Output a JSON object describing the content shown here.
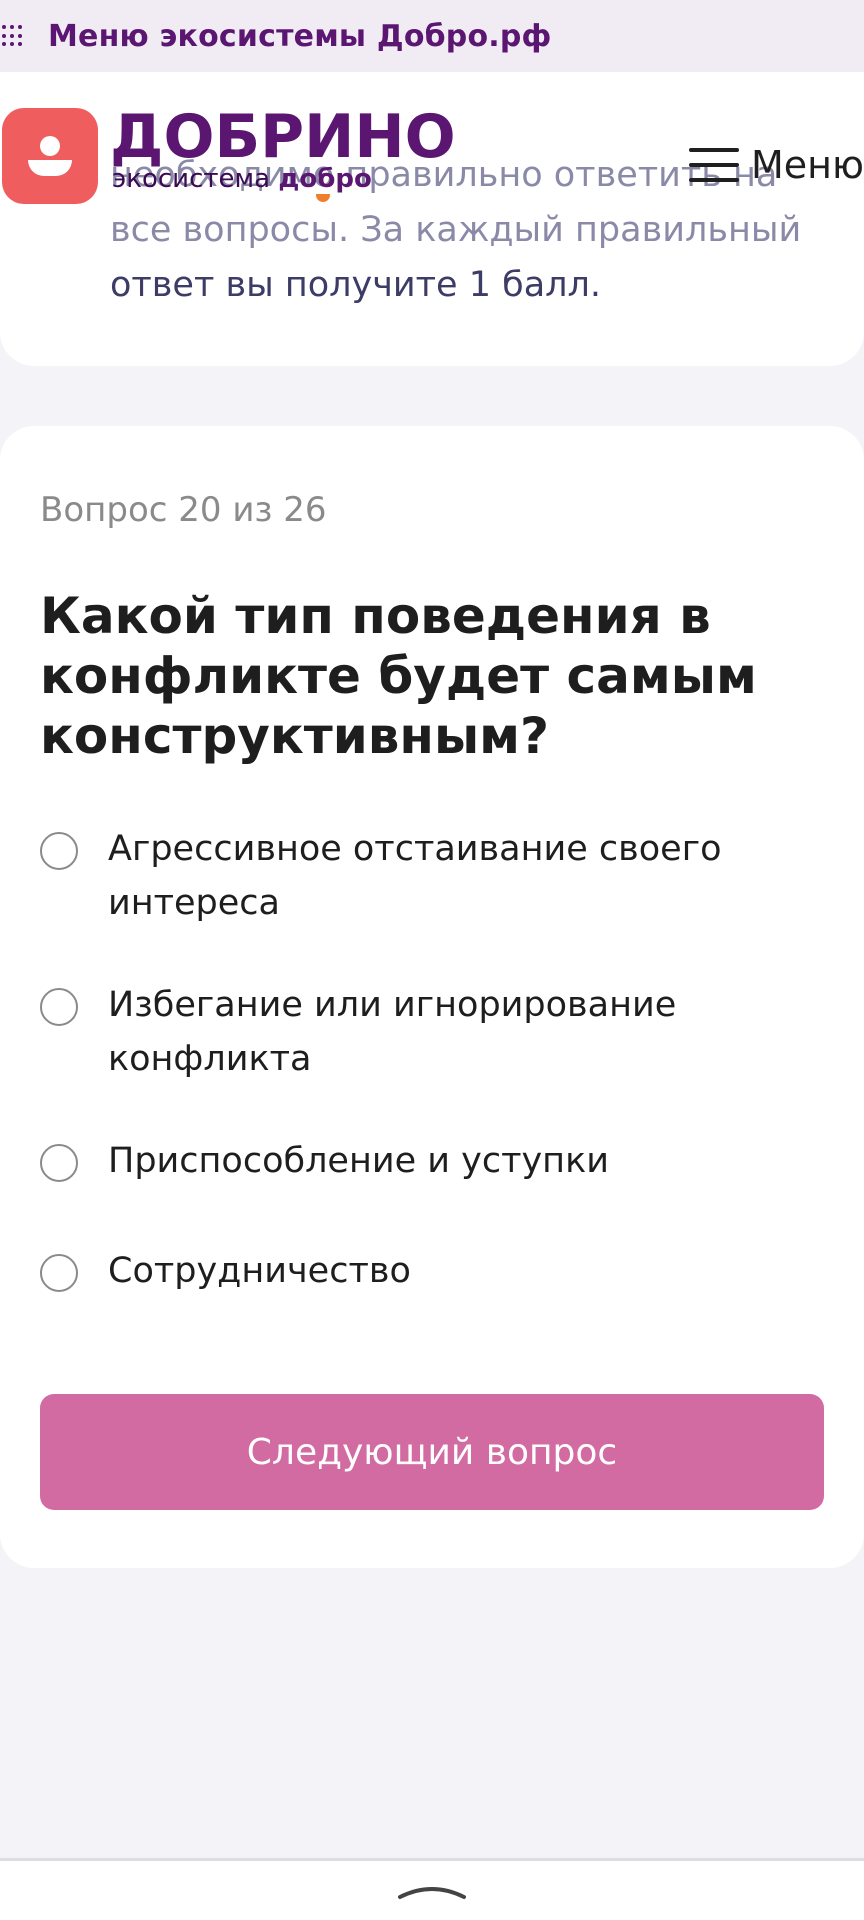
{
  "eco_bar": {
    "title": "Меню экосистемы Добро.рф"
  },
  "brand": {
    "name": "ДОБРИНО",
    "subtitle_plain": "экосистема ",
    "subtitle_bold": "добро",
    "menu_label": "Меню"
  },
  "intro": {
    "lines": [
      "необходимо правильно ответить на",
      "все вопросы. За каждый правильный",
      "ответ вы получите 1 балл."
    ]
  },
  "question": {
    "counter": "Вопрос 20 из 26",
    "title": "Какой тип поведения в конфликте будет самым конструктивным?",
    "options": [
      "Агрессивное отстаивание своего интереса",
      "Избегание или игнорирование конфликта",
      "Приспособление и уступки",
      "Сотрудничество"
    ],
    "next_button": "Следующий вопрос"
  },
  "colors": {
    "brand_purple": "#5b1672",
    "logo_coral": "#f05d5e",
    "button_pink": "#d36ba3",
    "background": "#f3f3f8"
  }
}
